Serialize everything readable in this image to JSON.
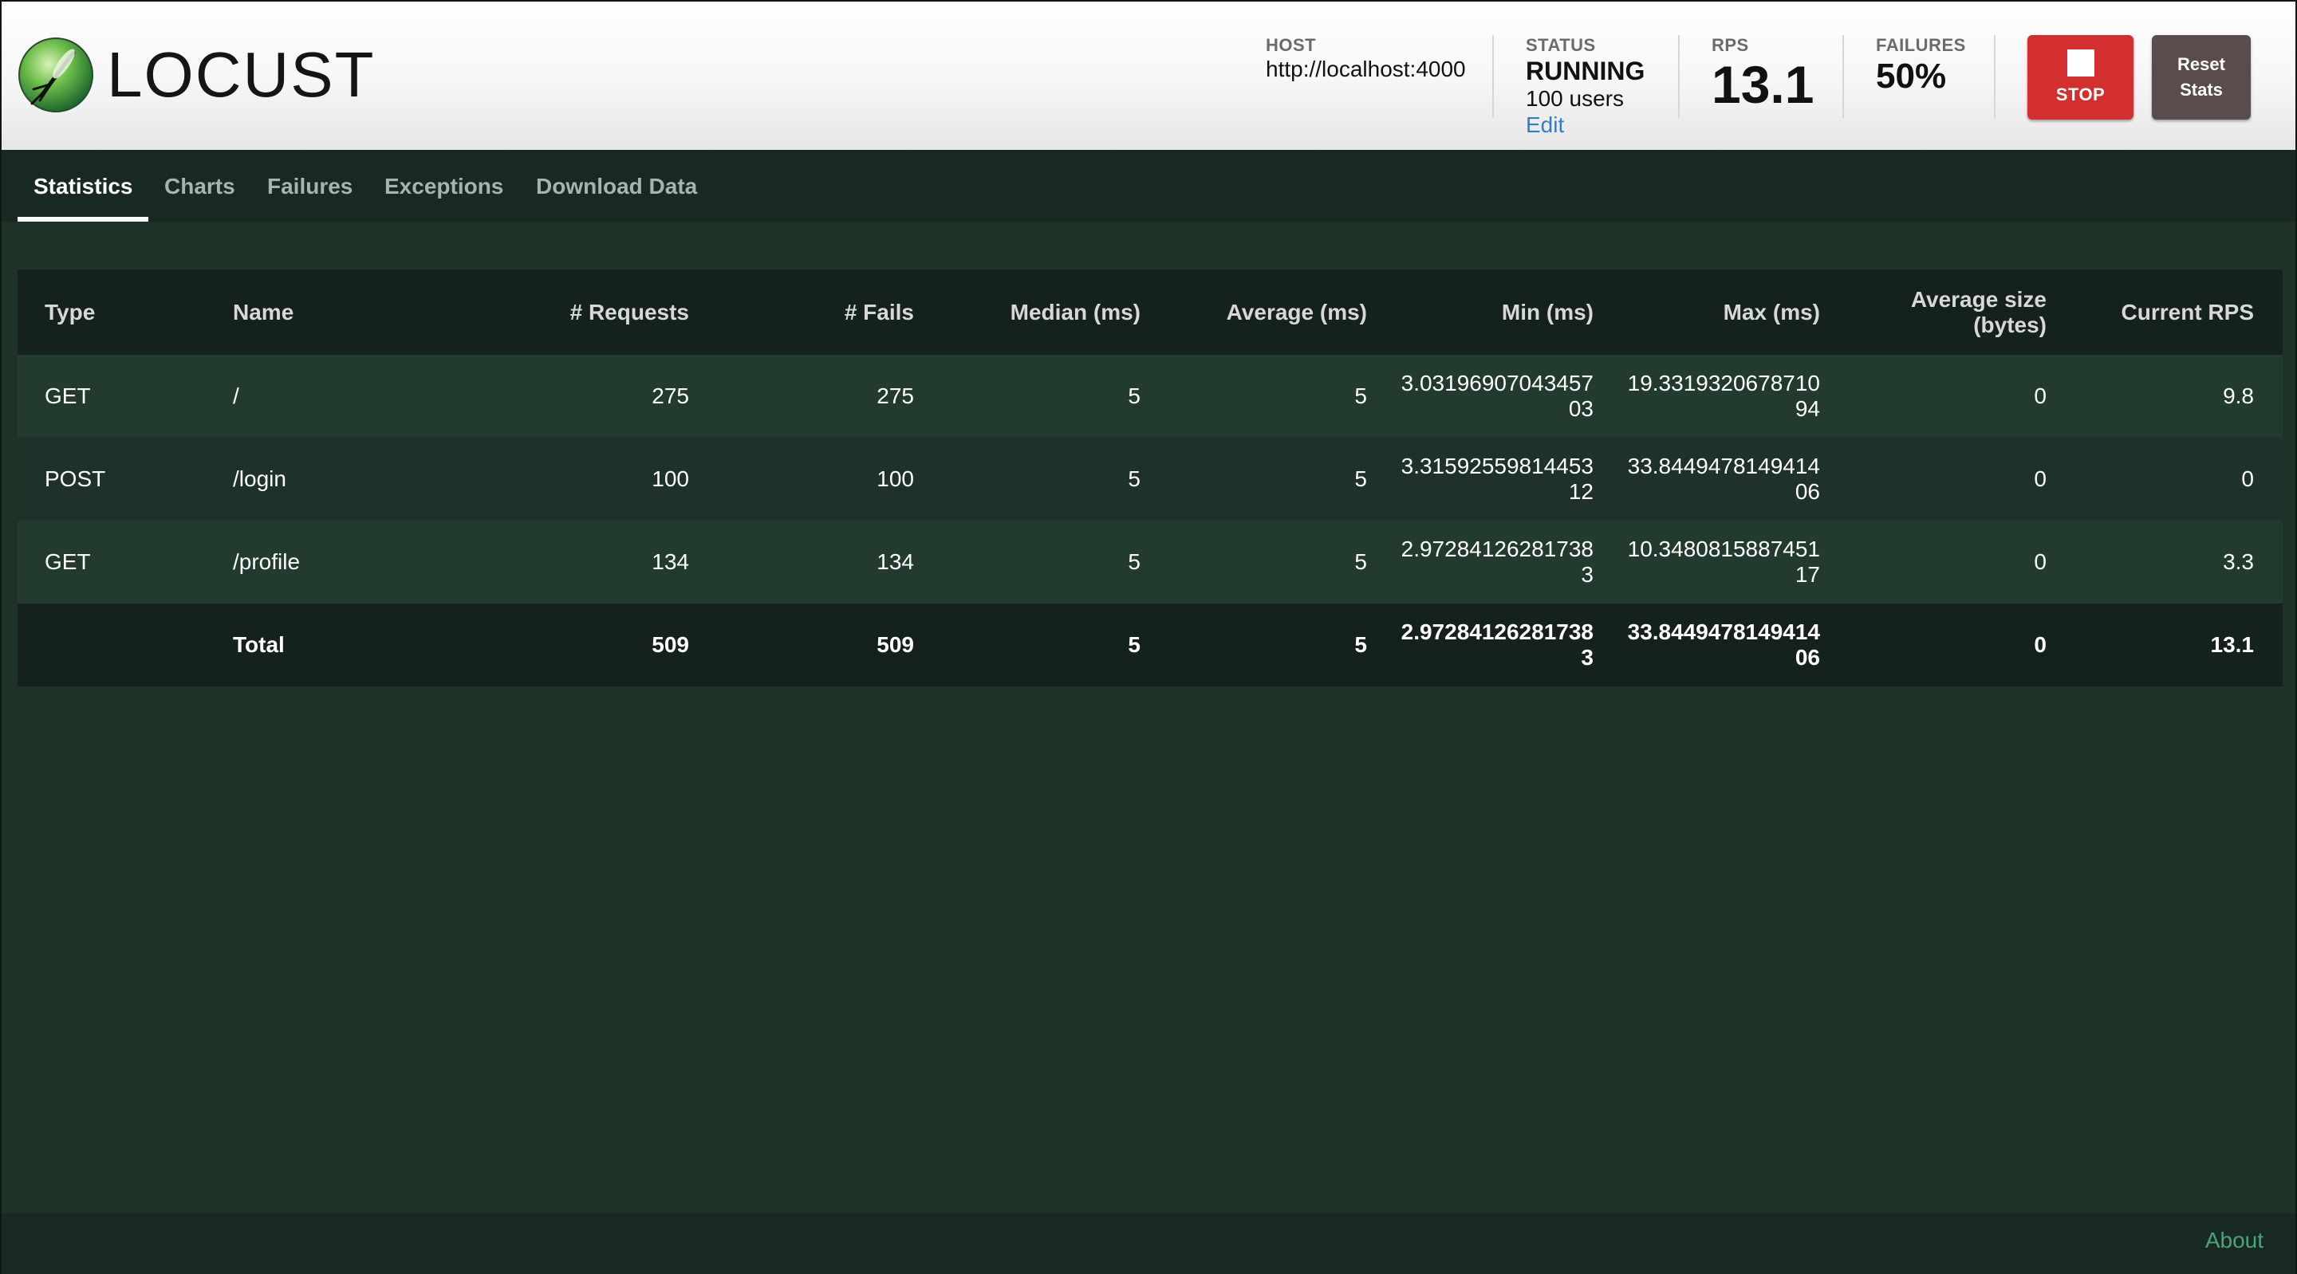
{
  "app": {
    "logo_text": "LOCUST"
  },
  "header": {
    "host_label": "HOST",
    "host_value": "http://localhost:4000",
    "status_label": "STATUS",
    "status_value": "RUNNING",
    "status_users": "100 users",
    "status_edit": "Edit",
    "rps_label": "RPS",
    "rps_value": "13.1",
    "failures_label": "FAILURES",
    "failures_value": "50%",
    "stop_label": "STOP",
    "reset_label_line1": "Reset",
    "reset_label_line2": "Stats"
  },
  "tabs": [
    {
      "label": "Statistics",
      "active": true
    },
    {
      "label": "Charts",
      "active": false
    },
    {
      "label": "Failures",
      "active": false
    },
    {
      "label": "Exceptions",
      "active": false
    },
    {
      "label": "Download Data",
      "active": false
    }
  ],
  "table": {
    "headers": [
      "Type",
      "Name",
      "# Requests",
      "# Fails",
      "Median (ms)",
      "Average (ms)",
      "Min (ms)",
      "Max (ms)",
      "Average size (bytes)",
      "Current RPS"
    ],
    "rows": [
      {
        "type": "GET",
        "name": "/",
        "requests": "275",
        "fails": "275",
        "median": "5",
        "average": "5",
        "min": "3.0319690704345703",
        "max": "19.331932067871094",
        "avg_size": "0",
        "current_rps": "9.8"
      },
      {
        "type": "POST",
        "name": "/login",
        "requests": "100",
        "fails": "100",
        "median": "5",
        "average": "5",
        "min": "3.3159255981445312",
        "max": "33.844947814941406",
        "avg_size": "0",
        "current_rps": "0"
      },
      {
        "type": "GET",
        "name": "/profile",
        "requests": "134",
        "fails": "134",
        "median": "5",
        "average": "5",
        "min": "2.972841262817383",
        "max": "10.348081588745117",
        "avg_size": "0",
        "current_rps": "3.3"
      }
    ],
    "total": {
      "type": "",
      "name": "Total",
      "requests": "509",
      "fails": "509",
      "median": "5",
      "average": "5",
      "min": "2.972841262817383",
      "max": "33.844947814941406",
      "avg_size": "0",
      "current_rps": "13.1"
    }
  },
  "footer": {
    "about_label": "About"
  },
  "colors": {
    "stop_button": "#d32f2f",
    "reset_button": "#5a4c4c",
    "background": "#1f3228",
    "link": "#2f7fc8",
    "about_link": "#4aa37a"
  }
}
